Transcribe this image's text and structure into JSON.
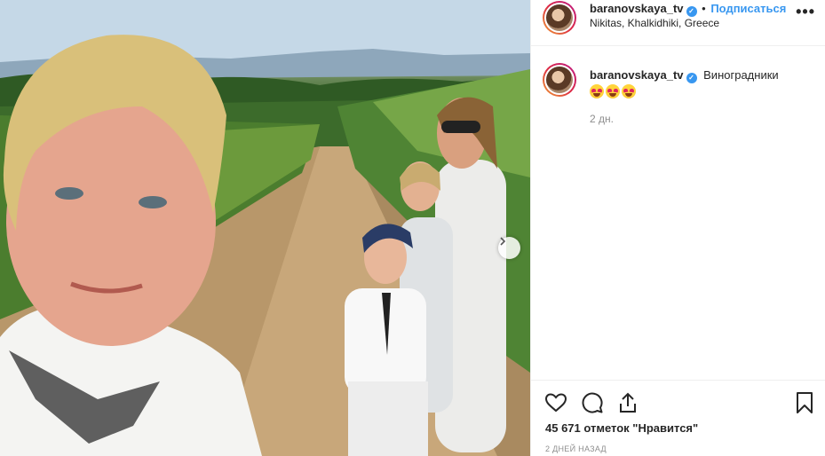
{
  "post": {
    "username": "baranovskaya_tv",
    "verified_mark": "✓",
    "follow_label": "Подписаться",
    "separator": "•",
    "location": "Nikitas, Khalkidhiki, Greece",
    "more_label": "•••"
  },
  "caption": {
    "username": "baranovskaya_tv",
    "text": "Виноградники",
    "emojis": [
      "star-struck-emoji",
      "star-struck-emoji",
      "star-struck-emoji"
    ],
    "time": "2 дн."
  },
  "actions": {
    "icons": [
      "heart-icon",
      "comment-icon",
      "share-icon",
      "bookmark-icon"
    ]
  },
  "likes": "45 671 отметок \"Нравится\"",
  "date": "2 ДНЕЙ НАЗАД",
  "colors": {
    "accent": "#3897f0",
    "text": "#262626",
    "muted": "#8e8e8e",
    "border": "#efefef"
  }
}
